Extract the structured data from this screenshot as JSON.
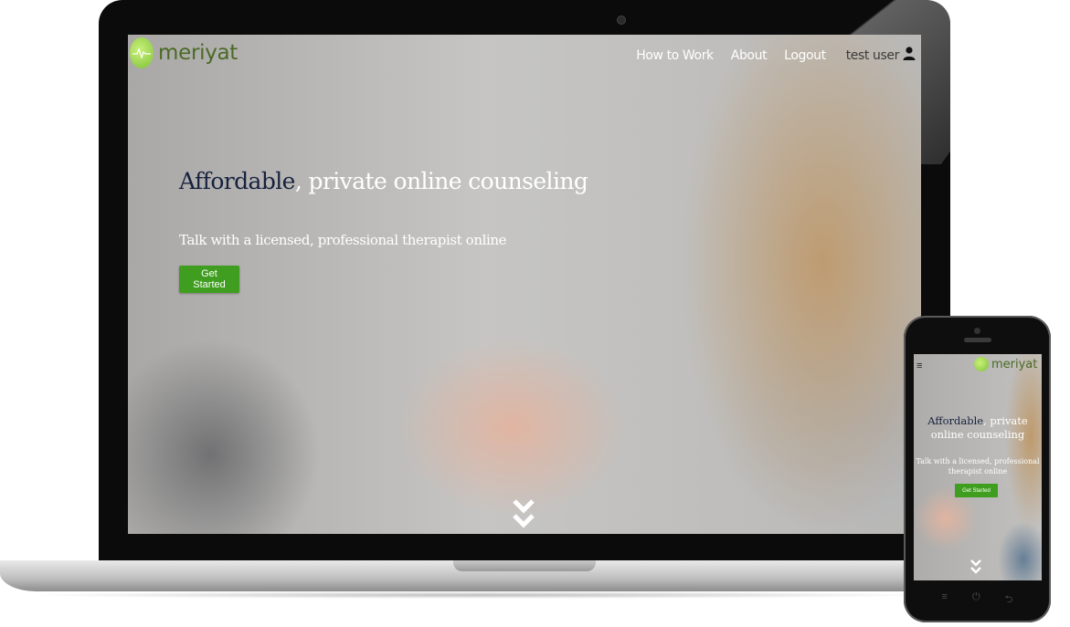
{
  "brand": {
    "name": "meriyat",
    "accent_color": "#3f9e1f",
    "logo_color": "#4a6a26"
  },
  "nav": {
    "links": [
      "How to Work",
      "About",
      "Logout"
    ],
    "user_label": "test user"
  },
  "hero": {
    "title_accent": "Affordable",
    "title_rest": ", private online counseling",
    "subtitle": "Talk with a licensed, professional therapist online",
    "cta_label": "Get Started"
  },
  "mobile": {
    "title_accent": "Affordable",
    "title_rest_line1": ", private",
    "title_rest_line2": "online counseling",
    "subtitle_line1": "Talk with a licensed, professional",
    "subtitle_line2": "therapist online",
    "cta_label": "Get Started",
    "menu_icon": "≡"
  },
  "icons": {
    "scroll": "double-chevron-down-icon",
    "user": "user-icon",
    "phone_buttons": [
      "≡",
      "⏻",
      "⮌"
    ]
  }
}
